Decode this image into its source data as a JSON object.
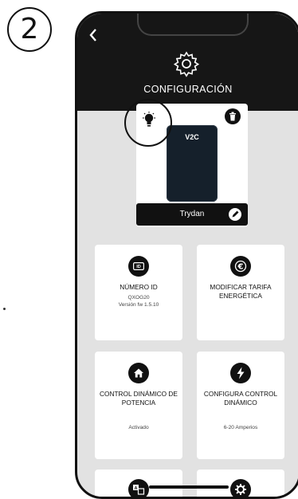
{
  "step_number": "2",
  "header": {
    "back_icon": "chevron-left-icon",
    "gear_icon": "gear-icon",
    "title": "CONFIGURACIÓN"
  },
  "device": {
    "badge": "V2C",
    "name": "Trydan"
  },
  "cards": [
    {
      "icon": "id-icon",
      "label": "NÚMERO ID",
      "sub1": "QXOG20",
      "sub2": "Versión fw 1.5.10"
    },
    {
      "icon": "euro-icon",
      "label": "MODIFICAR TARIFA ENERGÉTICA"
    },
    {
      "icon": "home-icon",
      "label": "CONTROL DINÁMICO DE POTENCIA",
      "sub1": "Activado"
    },
    {
      "icon": "lightning-icon",
      "label": "CONFIGURA CONTROL DINÁMICO",
      "sub1": "6-20 Amperios"
    }
  ],
  "colors": {
    "header": "#161616",
    "background": "#e2e2e2",
    "card": "#ffffff"
  }
}
